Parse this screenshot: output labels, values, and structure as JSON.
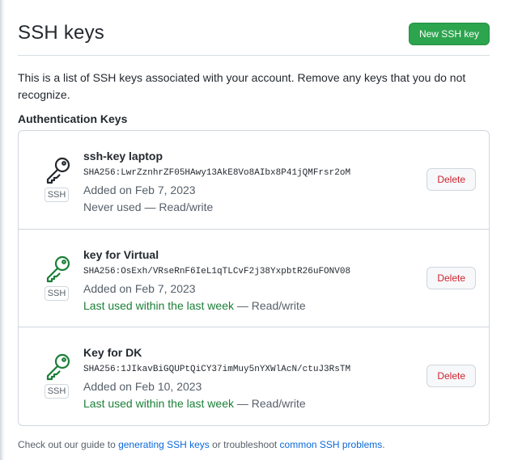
{
  "header": {
    "title": "SSH keys",
    "new_key_label": "New SSH key"
  },
  "intro_text": "This is a list of SSH keys associated with your account. Remove any keys that you do not recognize.",
  "section_title": "Authentication Keys",
  "keys": [
    {
      "title": "ssh-key laptop",
      "fingerprint": "SHA256:LwrZznhrZF05HAwy13AkE8Vo8AIbx8P41jQMFrsr2oM",
      "added": "Added on Feb 7, 2023",
      "usage_status": "Never used",
      "usage_suffix": " — Read/write",
      "badge": "SSH",
      "delete_label": "Delete",
      "icon_color": "#24292f"
    },
    {
      "title": "key for Virtual",
      "fingerprint": "SHA256:OsExh/VRseRnF6IeL1qTLCvF2j38YxpbtR26uFONV08",
      "added": "Added on Feb 7, 2023",
      "usage_status": "Last used within the last week",
      "usage_suffix": " — Read/write",
      "badge": "SSH",
      "delete_label": "Delete",
      "icon_color": "#1a7f37"
    },
    {
      "title": "Key for DK",
      "fingerprint": "SHA256:1JIkavBiGQUPtQiCY37imMuy5nYXWlAcN/ctuJ3RsTM",
      "added": "Added on Feb 10, 2023",
      "usage_status": "Last used within the last week",
      "usage_suffix": " — Read/write",
      "badge": "SSH",
      "delete_label": "Delete",
      "icon_color": "#1a7f37"
    }
  ],
  "footer": {
    "prefix": "Check out our guide to ",
    "link1": "generating SSH keys",
    "middle": " or troubleshoot ",
    "link2": "common SSH problems",
    "suffix": "."
  },
  "colors": {
    "primary_button": "#2da44e",
    "danger": "#cf222e",
    "success": "#1a7f37",
    "link": "#0969da"
  }
}
